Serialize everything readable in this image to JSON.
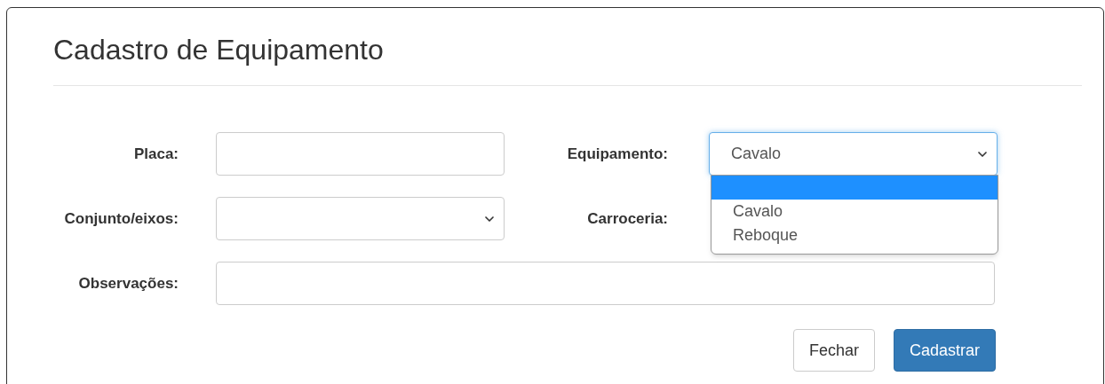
{
  "dialog": {
    "title": "Cadastro de Equipamento"
  },
  "fields": [
    {
      "label": "Placa:",
      "kind": "text"
    },
    {
      "label": "Equipamento:",
      "kind": "select",
      "value": "Cavalo",
      "focused": true,
      "dropdown": [
        {
          "highlighted": true
        },
        {
          "label": "Cavalo",
          "highlighted": false
        },
        {
          "label": "Reboque",
          "highlighted": false
        }
      ]
    },
    {
      "label": "Conjunto/eixos:",
      "kind": "select"
    },
    {
      "label": "Carroceria:",
      "kind": "hidden"
    },
    {
      "label": "Observações:",
      "kind": "text",
      "wide": true
    }
  ],
  "buttons": [
    {
      "label": "Fechar",
      "kind": "default"
    },
    {
      "label": "Cadastrar",
      "kind": "primary"
    }
  ]
}
